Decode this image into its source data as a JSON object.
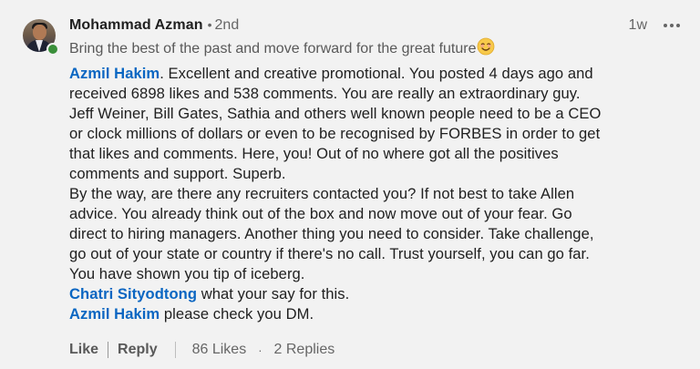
{
  "comment": {
    "author": "Mohammad Azman",
    "connection_degree": "2nd",
    "timestamp": "1w",
    "headline": "Bring the best of the past and move forward for the great future",
    "headline_emoji": "smiling-face-emoji",
    "paragraph1": {
      "mention": "Azmil Hakim",
      "lines": [
        ". Excellent and creative promotional. You posted 4 days ago and",
        "received 6898 likes and 538 comments. You are really an extraordinary guy.",
        "Jeff Weiner, Bill Gates, Sathia and others well known people need to be a CEO",
        "or clock millions of dollars or even to be recognised by FORBES in order to get",
        "that likes and comments. Here, you! Out of no where got all the positives",
        "comments and support. Superb.",
        "By the way, are there any recruiters contacted you? If not best to take Allen",
        "advice. You already think out of the box and now move out of your fear. Go",
        "direct to hiring managers. Another thing you need to consider. Take challenge,",
        "go out of your state or country if there's no call. Trust yourself, you can go far.",
        "You have shown you tip of iceberg."
      ]
    },
    "paragraph2": {
      "mention": "Chatri Sityodtong",
      "text": " what your say for this."
    },
    "paragraph3": {
      "mention": "Azmil Hakim",
      "text": " please check you DM."
    }
  },
  "actions": {
    "like_label": "Like",
    "reply_label": "Reply",
    "likes_count": "86 Likes",
    "separator": "·",
    "replies_count": "2 Replies"
  },
  "colors": {
    "background": "#f2f2f2",
    "mention": "#0a66c2",
    "online_status": "#3a8f3a",
    "secondary_text": "#666666"
  }
}
